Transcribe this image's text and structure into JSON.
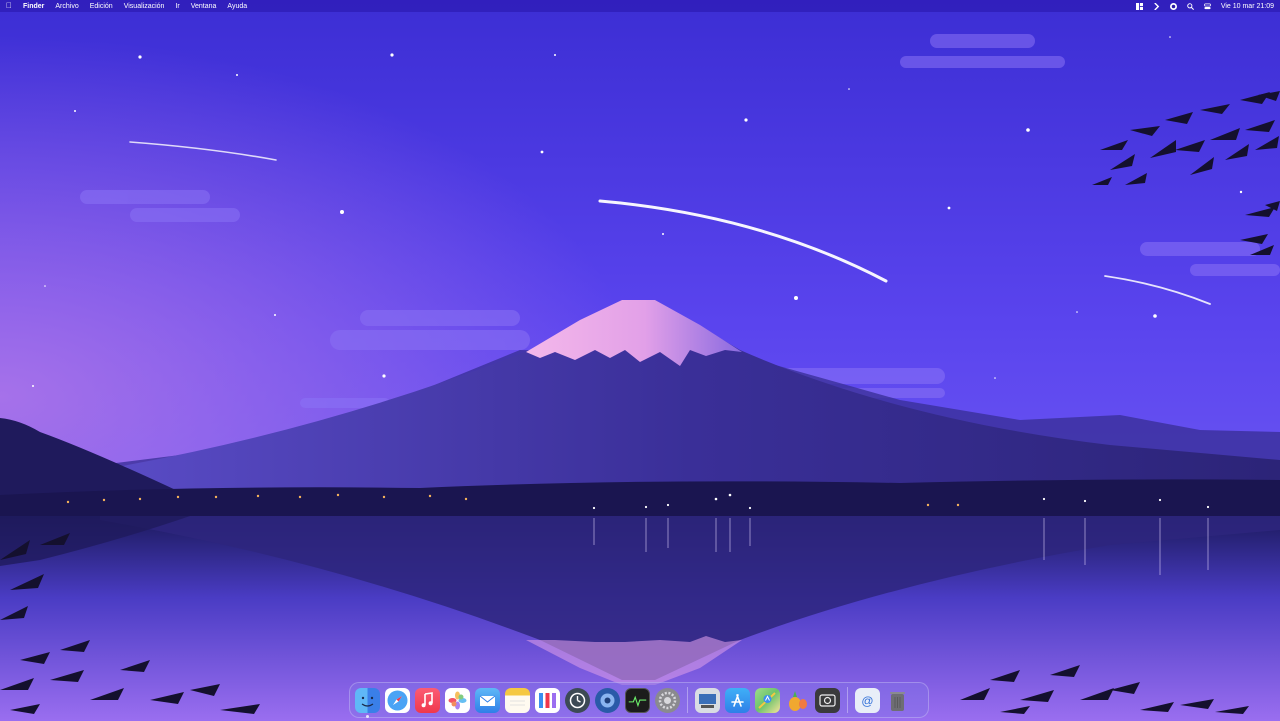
{
  "menubar": {
    "apple_icon": "apple-icon",
    "app_name": "Finder",
    "menus": [
      "Archivo",
      "Edición",
      "Visualización",
      "Ir",
      "Ventana",
      "Ayuda"
    ],
    "status_icons": [
      "layout-icon",
      "chevron-icon",
      "user-icon",
      "search-icon",
      "control-center-icon"
    ],
    "clock": "Vie 10 mar 21:09"
  },
  "dock": {
    "apps": [
      {
        "name": "Finder",
        "icon": "finder-icon",
        "color": "#3a8ff0"
      },
      {
        "name": "Safari",
        "icon": "safari-icon",
        "color": "#4aa3f5"
      },
      {
        "name": "Música",
        "icon": "music-icon",
        "color": "#f0384c"
      },
      {
        "name": "Fotos",
        "icon": "photos-icon",
        "color": "#ffffff"
      },
      {
        "name": "Mail",
        "icon": "mail-icon",
        "color": "#3a8ff0"
      },
      {
        "name": "Notas",
        "icon": "notes-icon",
        "color": "#f5c842"
      },
      {
        "name": "Recordatorios",
        "icon": "reminders-icon",
        "color": "#ffffff"
      },
      {
        "name": "Time Machine",
        "icon": "time-machine-icon",
        "color": "#3c4a54"
      },
      {
        "name": "Utilidad",
        "icon": "utility-icon",
        "color": "#2a5aa8"
      },
      {
        "name": "Monitor de Actividad",
        "icon": "activity-monitor-icon",
        "color": "#1c1c1c"
      },
      {
        "name": "Ajustes del Sistema",
        "icon": "settings-icon",
        "color": "#8a8a8e"
      },
      {
        "name": "Vista Previa",
        "icon": "preview-icon",
        "color": "#d9dde3"
      },
      {
        "name": "App Store",
        "icon": "app-store-icon",
        "color": "#2f8bf5"
      },
      {
        "name": "Mapas",
        "icon": "maps-icon",
        "color": "#6cc36b"
      },
      {
        "name": "Ananas",
        "icon": "pineapple-icon",
        "color": "#f0a830"
      },
      {
        "name": "Captura",
        "icon": "screenshot-icon",
        "color": "#3a3a3c"
      },
      {
        "name": "Documento",
        "icon": "document-icon",
        "color": "#e8eef8"
      },
      {
        "name": "Papelera",
        "icon": "trash-icon",
        "color": "#6e6e74"
      }
    ]
  }
}
